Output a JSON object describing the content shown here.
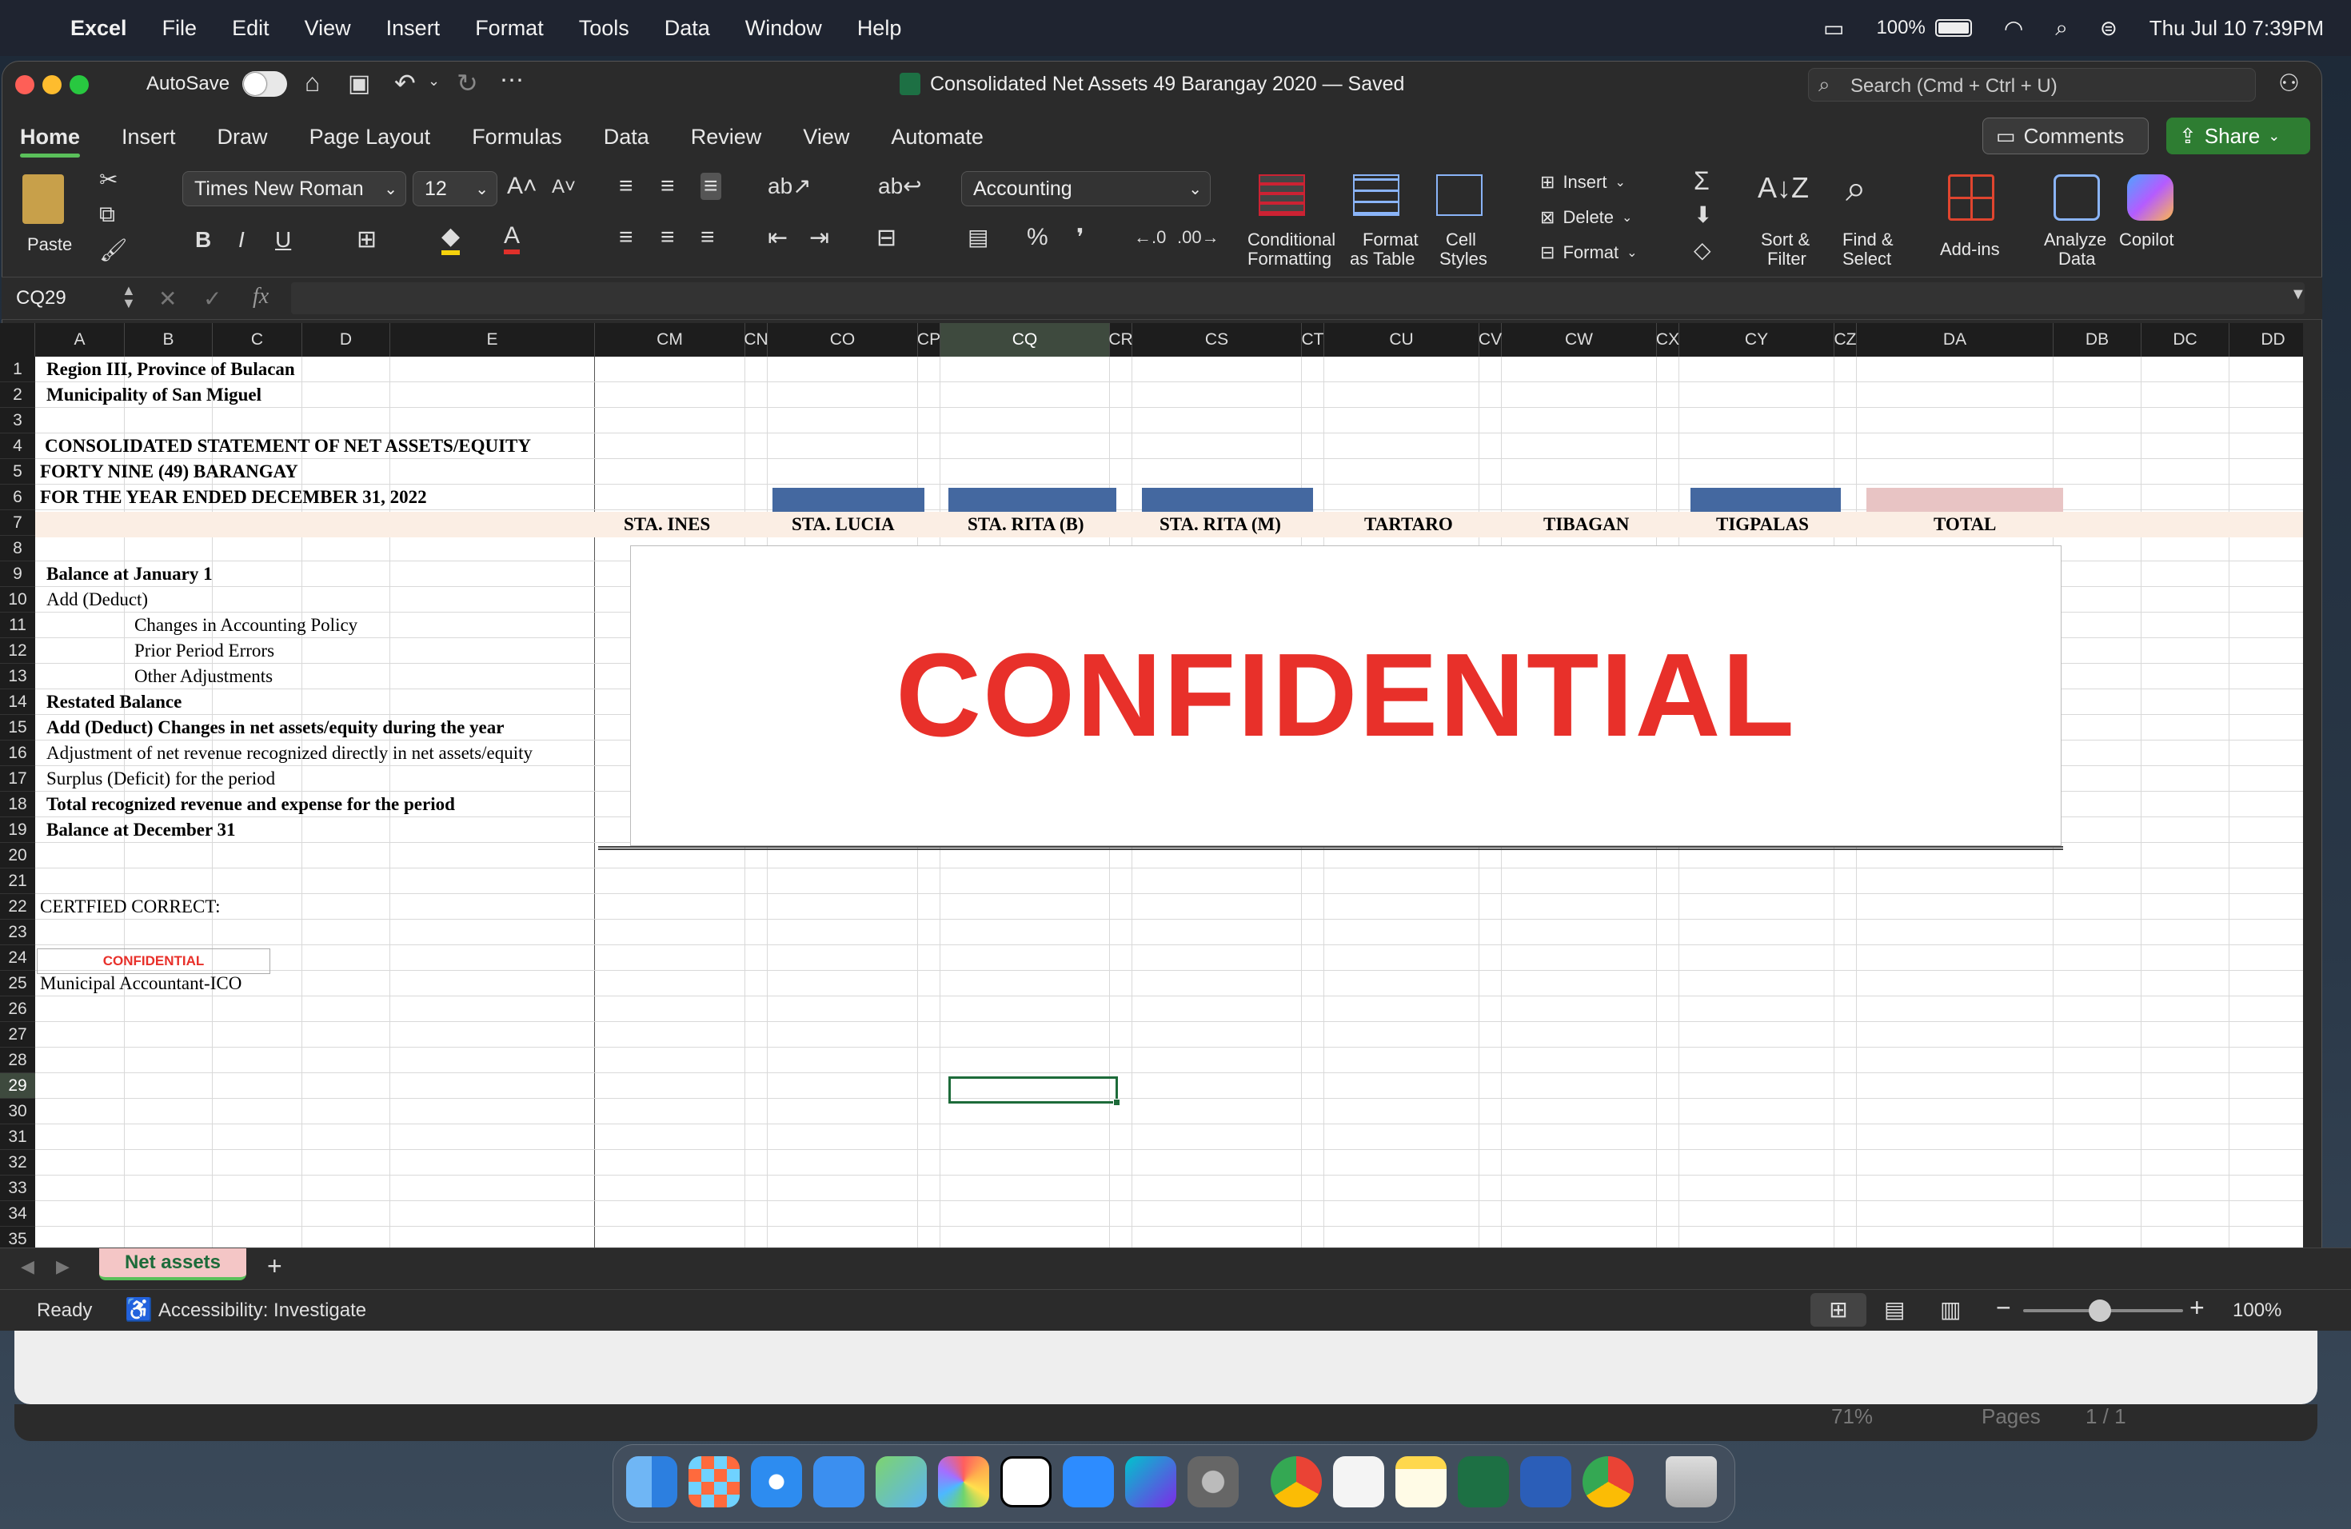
{
  "menubar": {
    "app": "Excel",
    "items": [
      "File",
      "Edit",
      "View",
      "Insert",
      "Format",
      "Tools",
      "Data",
      "Window",
      "Help"
    ],
    "battery": "100%",
    "datetime": "Thu Jul 10  7:39PM"
  },
  "titlebar": {
    "autosave": "AutoSave",
    "doc_title": "Consolidated Net Assets 49 Barangay 2020 — Saved",
    "search_placeholder": "Search (Cmd + Ctrl + U)"
  },
  "tabs": [
    "Home",
    "Insert",
    "Draw",
    "Page Layout",
    "Formulas",
    "Data",
    "Review",
    "View",
    "Automate"
  ],
  "actions": {
    "comments": "Comments",
    "share": "Share"
  },
  "ribbon": {
    "paste": "Paste",
    "font_name": "Times New Roman",
    "font_size": "12",
    "number_format": "Accounting",
    "conditional": [
      "Conditional",
      "Formatting"
    ],
    "format_table": [
      "Format",
      "as Table"
    ],
    "cell_styles": [
      "Cell",
      "Styles"
    ],
    "insert": "Insert",
    "delete": "Delete",
    "format": "Format",
    "sort": [
      "Sort &",
      "Filter"
    ],
    "find": [
      "Find &",
      "Select"
    ],
    "addins": "Add-ins",
    "analyze": [
      "Analyze",
      "Data"
    ],
    "copilot": "Copilot"
  },
  "formula": {
    "name_box": "CQ29",
    "fx": "fx",
    "value": ""
  },
  "columns": [
    "A",
    "B",
    "C",
    "D",
    "E",
    "CM",
    "CN",
    "CO",
    "CP",
    "CQ",
    "CR",
    "CS",
    "CT",
    "CU",
    "CV",
    "CW",
    "CX",
    "CY",
    "CZ",
    "DA",
    "DB",
    "DC",
    "DD"
  ],
  "selected_column": "CQ",
  "selected_row": 29,
  "rows": [
    1,
    2,
    3,
    4,
    5,
    6,
    7,
    8,
    9,
    10,
    11,
    12,
    13,
    14,
    15,
    16,
    17,
    18,
    19,
    20,
    21,
    22,
    23,
    24,
    25,
    26,
    27,
    28,
    29,
    30,
    31,
    32,
    33,
    34,
    35
  ],
  "cells": {
    "r1": "Region III, Province of Bulacan",
    "r2": "Municipality of San Miguel",
    "r4": "CONSOLIDATED STATEMENT OF NET ASSETS/EQUITY",
    "r5": "FORTY NINE (49) BARANGAY",
    "r6": "FOR THE YEAR ENDED DECEMBER 31, 2022",
    "r9": "Balance at January 1",
    "r10": "Add (Deduct)",
    "r11": "Changes in Accounting Policy",
    "r12": "Prior Period Errors",
    "r13": "Other Adjustments",
    "r14": "Restated Balance",
    "r15": "Add (Deduct) Changes in net assets/equity during the year",
    "r16": "Adjustment of net revenue recognized directly in net assets/equity",
    "r17": "Surplus (Deficit) for the period",
    "r18": "Total recognized revenue and expense for the period",
    "r19": "Balance at December 31",
    "r22": "CERTFIED CORRECT:",
    "r24": "CONFIDENTIAL",
    "r25": "Municipal Accountant-ICO"
  },
  "headers_row7": [
    "STA. INES",
    "STA. LUCIA",
    "STA. RITA (B)",
    "STA. RITA (M)",
    "TARTARO",
    "TIBAGAN",
    "TIGPALAS",
    "TOTAL"
  ],
  "overlay_text": "CONFIDENTIAL",
  "sheet_tab": "Net assets",
  "status": {
    "ready": "Ready",
    "accessibility": "Accessibility: Investigate",
    "zoom": "100%"
  },
  "bg_window": {
    "zoom": "71%",
    "pages": "Pages",
    "page_count": "1 / 1"
  },
  "colors": {
    "accent_green": "#5ac05a",
    "confidential_red": "#e8302a",
    "header_blue": "#4468a0",
    "total_pink": "#e8c4c4",
    "row7_band": "#fbeee4",
    "tab_pink": "#f4c6c6"
  }
}
